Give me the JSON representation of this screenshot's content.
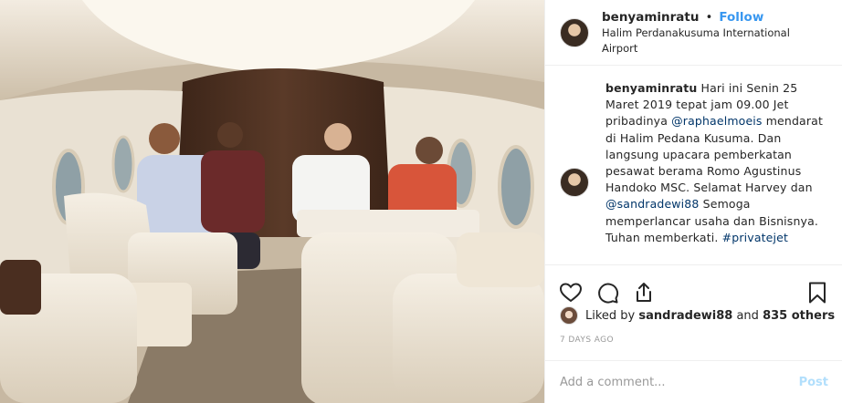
{
  "post": {
    "username": "benyaminratu",
    "follow_label": "Follow",
    "separator": "•",
    "location": "Halim Perdanakusuma International Airport"
  },
  "caption": {
    "username": "benyaminratu",
    "text_1": "Hari ini Senin 25 Maret 2019 tepat jam 09.00 Jet pribadinya ",
    "mention_1": "@raphaelmoeis",
    "text_2": " mendarat di Halim Pedana Kusuma. Dan langsung upacara pemberkatan pesawat berama Romo Agustinus Handoko MSC. Selamat Harvey dan ",
    "mention_2": "@sandradewi88",
    "text_3": " Semoga memperlancar usaha dan Bisnisnya. Tuhan memberkati. ",
    "hashtag": "#privatejet"
  },
  "actions": {
    "like_icon": "heart-icon",
    "comment_icon": "comment-icon",
    "share_icon": "share-icon",
    "save_icon": "bookmark-icon"
  },
  "likes": {
    "prefix": "Liked by ",
    "user": "sandradewi88",
    "middle": " and ",
    "others": "835 others"
  },
  "timestamp": "7 DAYS AGO",
  "comment": {
    "placeholder": "Add a comment...",
    "post_label": "Post"
  },
  "colors": {
    "link": "#3897f0",
    "mention": "#003569",
    "post_disabled": "#b2dffc"
  }
}
